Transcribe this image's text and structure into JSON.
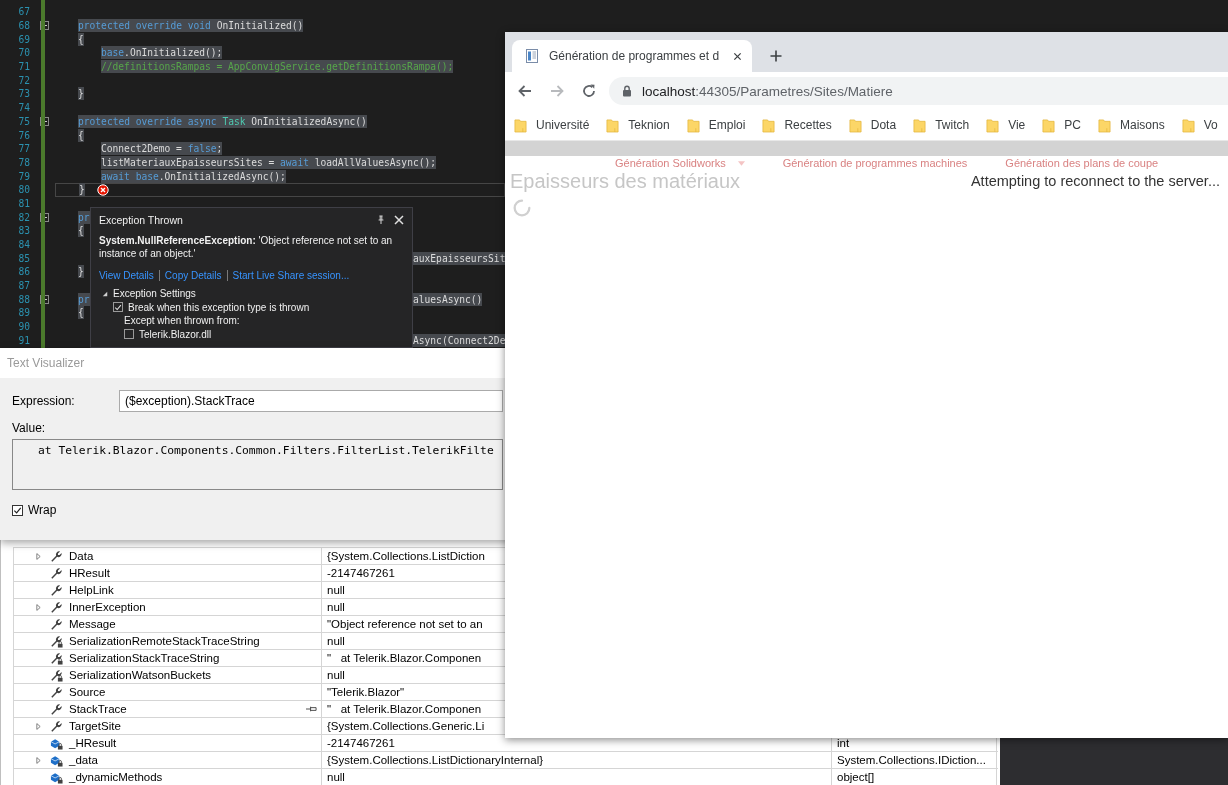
{
  "editor": {
    "lines": [
      {
        "number": "67",
        "kind": "blank",
        "foldable": false,
        "current": false,
        "error": false
      },
      {
        "number": "68",
        "kind": "member",
        "foldable": true,
        "highlighted": true,
        "current": false,
        "error": false,
        "segments": [
          {
            "kind": "keyword",
            "text": "protected override void"
          },
          {
            "kind": "plain",
            "text": " OnInitialized()"
          }
        ]
      },
      {
        "number": "69",
        "kind": "member",
        "foldable": false,
        "highlighted": true,
        "current": false,
        "error": false,
        "segments": [
          {
            "kind": "plain",
            "text": "{"
          }
        ]
      },
      {
        "number": "70",
        "kind": "body",
        "foldable": false,
        "highlighted": true,
        "current": false,
        "error": false,
        "segments": [
          {
            "kind": "keyword",
            "text": "base"
          },
          {
            "kind": "plain",
            "text": ".OnInitialized();"
          }
        ]
      },
      {
        "number": "71",
        "kind": "body",
        "foldable": false,
        "highlighted": true,
        "current": false,
        "error": false,
        "segments": [
          {
            "kind": "comment",
            "text": "//definitionsRampas = AppConvigService.getDefinitionsRampa();"
          }
        ]
      },
      {
        "number": "72",
        "kind": "blank",
        "foldable": false,
        "current": false,
        "error": false
      },
      {
        "number": "73",
        "kind": "member",
        "foldable": false,
        "highlighted": true,
        "current": false,
        "error": false,
        "segments": [
          {
            "kind": "plain",
            "text": "}"
          }
        ]
      },
      {
        "number": "74",
        "kind": "blank",
        "foldable": false,
        "current": false,
        "error": false
      },
      {
        "number": "75",
        "kind": "member",
        "foldable": true,
        "highlighted": true,
        "current": false,
        "error": false,
        "segments": [
          {
            "kind": "keyword",
            "text": "protected override async "
          },
          {
            "kind": "type",
            "text": "Task"
          },
          {
            "kind": "plain",
            "text": " OnInitializedAsync()"
          }
        ]
      },
      {
        "number": "76",
        "kind": "member",
        "foldable": false,
        "highlighted": true,
        "current": false,
        "error": false,
        "segments": [
          {
            "kind": "plain",
            "text": "{"
          }
        ]
      },
      {
        "number": "77",
        "kind": "body",
        "foldable": false,
        "highlighted": true,
        "current": false,
        "error": false,
        "segments": [
          {
            "kind": "plain",
            "text": "Connect2Demo = "
          },
          {
            "kind": "keyword",
            "text": "false"
          },
          {
            "kind": "plain",
            "text": ";"
          }
        ]
      },
      {
        "number": "78",
        "kind": "body",
        "foldable": false,
        "highlighted": true,
        "current": false,
        "error": false,
        "segments": [
          {
            "kind": "plain",
            "text": "listMateriauxEpaisseursSites = "
          },
          {
            "kind": "keyword",
            "text": "await"
          },
          {
            "kind": "plain",
            "text": " loadAllValuesAsync();"
          }
        ]
      },
      {
        "number": "79",
        "kind": "body",
        "foldable": false,
        "highlighted": true,
        "current": false,
        "error": false,
        "segments": [
          {
            "kind": "keyword",
            "text": "await base"
          },
          {
            "kind": "plain",
            "text": ".OnInitializedAsync();"
          }
        ]
      },
      {
        "number": "80",
        "kind": "member",
        "foldable": false,
        "highlighted": true,
        "current": true,
        "error": true,
        "segments": [
          {
            "kind": "plain",
            "text": "}"
          }
        ]
      },
      {
        "number": "81",
        "kind": "blank",
        "foldable": false,
        "current": false,
        "error": false
      },
      {
        "number": "82",
        "kind": "member",
        "foldable": true,
        "highlighted": true,
        "current": false,
        "error": false,
        "segments": [
          {
            "kind": "keyword",
            "text": "pr"
          }
        ]
      },
      {
        "number": "83",
        "kind": "member",
        "foldable": false,
        "highlighted": true,
        "current": false,
        "error": false,
        "segments": [
          {
            "kind": "plain",
            "text": "{"
          }
        ]
      },
      {
        "number": "84",
        "kind": "blank",
        "foldable": false,
        "current": false,
        "error": false
      },
      {
        "number": "85",
        "kind": "blank",
        "foldable": false,
        "highlighted": true,
        "current": false,
        "error": false,
        "tail": [
          {
            "kind": "plain",
            "text": "auxEpaisseursSit"
          }
        ]
      },
      {
        "number": "86",
        "kind": "member",
        "foldable": false,
        "highlighted": true,
        "current": false,
        "error": false,
        "segments": [
          {
            "kind": "plain",
            "text": "}"
          }
        ]
      },
      {
        "number": "87",
        "kind": "blank",
        "foldable": false,
        "current": false,
        "error": false
      },
      {
        "number": "88",
        "kind": "member",
        "foldable": true,
        "highlighted": true,
        "current": false,
        "error": false,
        "segments": [
          {
            "kind": "keyword",
            "text": "pr"
          }
        ],
        "tail": [
          {
            "kind": "plain",
            "text": "aluesAsync()"
          }
        ]
      },
      {
        "number": "89",
        "kind": "member",
        "foldable": false,
        "highlighted": true,
        "current": false,
        "error": false,
        "segments": [
          {
            "kind": "plain",
            "text": "{"
          }
        ]
      },
      {
        "number": "90",
        "kind": "blank",
        "foldable": false,
        "current": false,
        "error": false
      },
      {
        "number": "91",
        "kind": "blank",
        "foldable": false,
        "highlighted": true,
        "current": false,
        "error": false,
        "tail": [
          {
            "kind": "plain",
            "text": "Async(Connect2De"
          }
        ]
      }
    ]
  },
  "exception_popup": {
    "title": "Exception Thrown",
    "message": "**System.NullReferenceException:** 'Object reference not set to an instance of an object.'",
    "links": [
      "View Details",
      "Copy Details",
      "Start Live Share session..."
    ],
    "settings": {
      "label": "Exception Settings",
      "expanded": true,
      "break_option": {
        "label": "Break when this exception type is thrown",
        "checked": true
      },
      "except_label": "Except when thrown from:",
      "modules": [
        {
          "label": "Telerik.Blazor.dll",
          "checked": false
        }
      ]
    }
  },
  "text_visualizer": {
    "title": "Text Visualizer",
    "expression_label": "Expression:",
    "expression": "($exception).StackTrace",
    "value_label": "Value:",
    "value": "at Telerik.Blazor.Components.Common.Filters.FilterList.TelerikFilte",
    "wrap": {
      "label": "Wrap",
      "checked": true
    }
  },
  "locals": {
    "rows": [
      {
        "name": "Data",
        "kind": "property",
        "expandable": true,
        "pinned": false,
        "value": "{System.Collections.ListDiction"
      },
      {
        "name": "HResult",
        "kind": "property",
        "expandable": false,
        "pinned": false,
        "value": "-2147467261"
      },
      {
        "name": "HelpLink",
        "kind": "property",
        "expandable": false,
        "pinned": false,
        "value": "null"
      },
      {
        "name": "InnerException",
        "kind": "property",
        "expandable": true,
        "pinned": false,
        "value": "null"
      },
      {
        "name": "Message",
        "kind": "property",
        "expandable": false,
        "pinned": false,
        "value": "\"Object reference not set to an"
      },
      {
        "name": "SerializationRemoteStackTraceString",
        "kind": "private-property",
        "expandable": false,
        "pinned": false,
        "value": "null"
      },
      {
        "name": "SerializationStackTraceString",
        "kind": "private-property",
        "expandable": false,
        "pinned": false,
        "value": "\"   at Telerik.Blazor.Componen"
      },
      {
        "name": "SerializationWatsonBuckets",
        "kind": "private-property",
        "expandable": false,
        "pinned": false,
        "value": "null"
      },
      {
        "name": "Source",
        "kind": "property",
        "expandable": false,
        "pinned": false,
        "value": "\"Telerik.Blazor\""
      },
      {
        "name": "StackTrace",
        "kind": "property",
        "expandable": false,
        "pinned": true,
        "value": "\"   at Telerik.Blazor.Componen"
      },
      {
        "name": "TargetSite",
        "kind": "property",
        "expandable": true,
        "pinned": false,
        "value": "{System.Collections.Generic.Li"
      },
      {
        "name": "_HResult",
        "kind": "private-field",
        "expandable": false,
        "pinned": false,
        "value": "-2147467261",
        "type": "int"
      },
      {
        "name": "_data",
        "kind": "private-field",
        "expandable": true,
        "pinned": false,
        "value": "{System.Collections.ListDictionaryInternal}",
        "type": "System.Collections.IDiction..."
      },
      {
        "name": "_dynamicMethods",
        "kind": "private-field",
        "expandable": false,
        "pinned": false,
        "value": "null",
        "type": "object[]"
      }
    ]
  },
  "browser": {
    "tab": {
      "title": "Génération de programmes et d"
    },
    "nav_buttons": [
      {
        "kind": "back",
        "disabled": false
      },
      {
        "kind": "forward",
        "disabled": true
      },
      {
        "kind": "reload",
        "disabled": false
      }
    ],
    "address": {
      "host": "localhost",
      "path": ":44305/Parametres/Sites/Matiere"
    },
    "bookmarks": [
      "Université",
      "Teknion",
      "Emploi",
      "Recettes",
      "Dota",
      "Twitch",
      "Vie",
      "PC",
      "Maisons",
      "Vo"
    ],
    "page": {
      "nav": [
        {
          "label": "Génération Solidworks",
          "dropdown": true
        },
        {
          "label": "Génération de programmes machines",
          "dropdown": false
        },
        {
          "label": "Génération des plans de coupe",
          "dropdown": false
        }
      ],
      "heading": "Epaisseurs des matériaux",
      "reconnect_message": "Attempting to reconnect to the server..."
    }
  }
}
